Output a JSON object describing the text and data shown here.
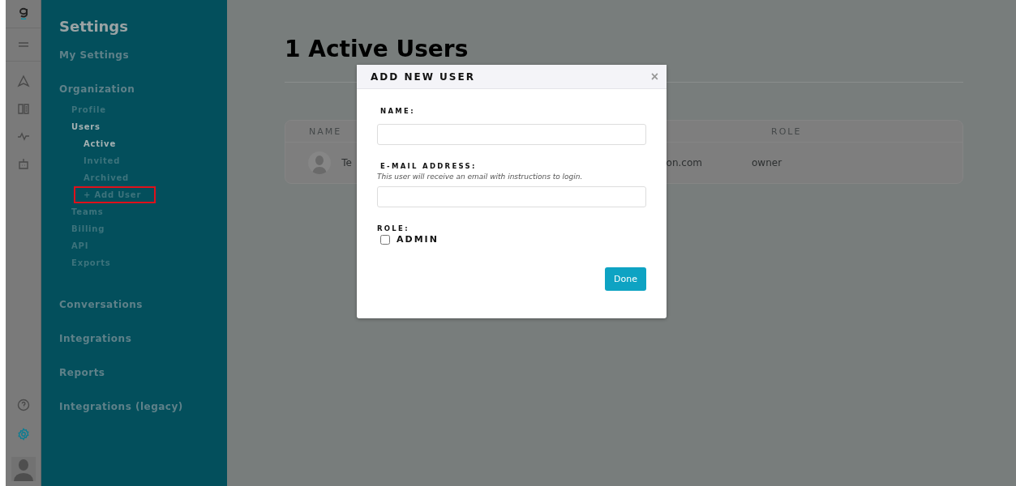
{
  "sidebar": {
    "title": "Settings",
    "sections": [
      {
        "label": "My Settings"
      },
      {
        "label": "Organization",
        "children": [
          {
            "label": "Profile",
            "selected": false,
            "highlighted": false
          },
          {
            "label": "Users",
            "selected": true,
            "highlighted": false,
            "children": [
              {
                "label": "Active",
                "selected": true,
                "highlighted": false
              },
              {
                "label": "Invited",
                "selected": false,
                "highlighted": false
              },
              {
                "label": "Archived",
                "selected": false,
                "highlighted": false
              },
              {
                "label": "+ Add User",
                "selected": false,
                "highlighted": true
              }
            ]
          },
          {
            "label": "Teams",
            "selected": false,
            "highlighted": false
          },
          {
            "label": "Billing",
            "selected": false,
            "highlighted": false
          },
          {
            "label": "API",
            "selected": false,
            "highlighted": false
          },
          {
            "label": "Exports",
            "selected": false,
            "highlighted": false
          }
        ]
      },
      {
        "label": "Conversations"
      },
      {
        "label": "Integrations"
      },
      {
        "label": "Reports"
      },
      {
        "label": "Integrations (legacy)"
      }
    ]
  },
  "main": {
    "title": "1 Active Users",
    "table": {
      "columns": [
        "NAME",
        "ROLE"
      ],
      "rows": [
        {
          "name": "Te",
          "email": "on.com",
          "role": "owner"
        }
      ]
    }
  },
  "dialog": {
    "title": "ADD NEW USER",
    "close": "×",
    "fields": [
      {
        "label": "NAME:"
      },
      {
        "label": "E-MAIL ADDRESS:",
        "hint": "This user will receive an email with instructions to login."
      }
    ],
    "role_label": "ROLE:",
    "admin": {
      "label": "ADMIN",
      "checked": false
    },
    "button": "Done"
  }
}
